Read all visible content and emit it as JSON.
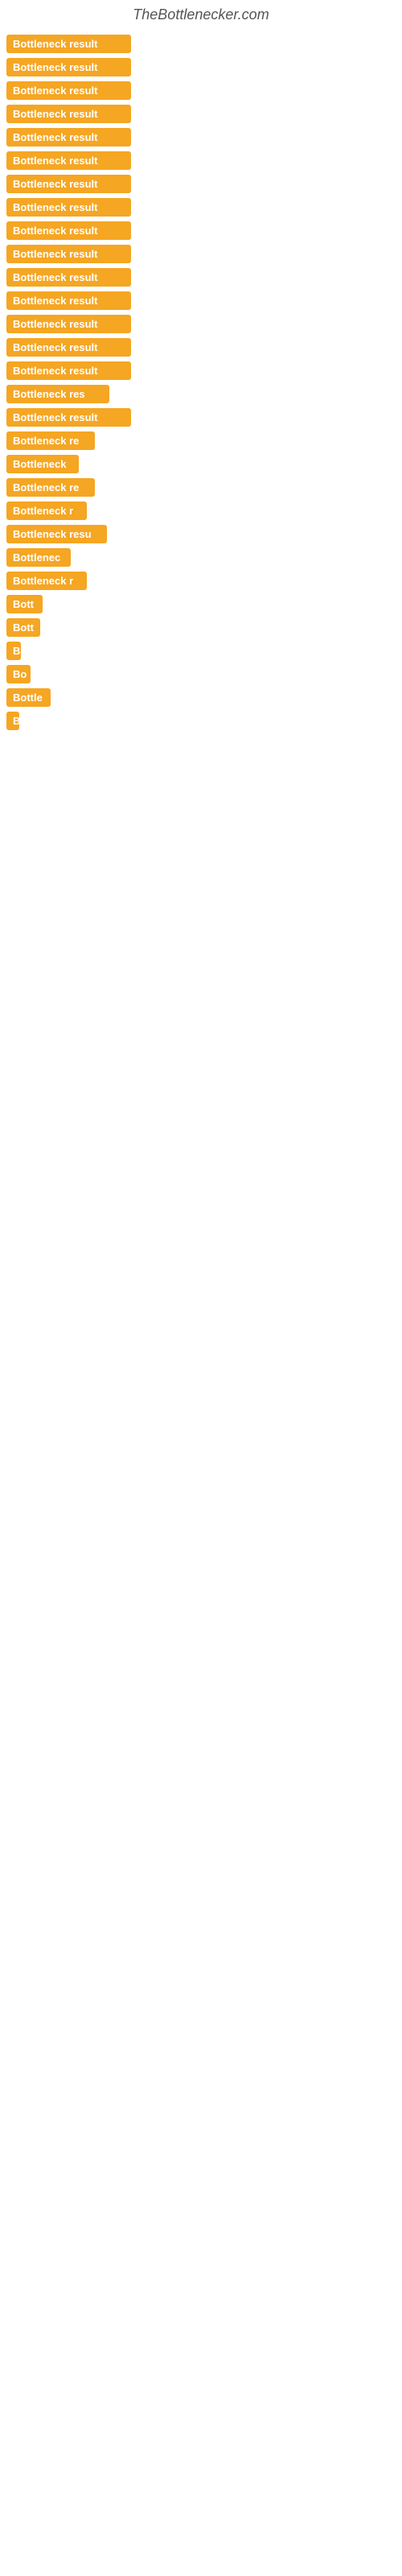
{
  "site": {
    "title": "TheBottlenecker.com"
  },
  "items": [
    {
      "label": "Bottleneck result",
      "width": 155
    },
    {
      "label": "Bottleneck result",
      "width": 155
    },
    {
      "label": "Bottleneck result",
      "width": 155
    },
    {
      "label": "Bottleneck result",
      "width": 155
    },
    {
      "label": "Bottleneck result",
      "width": 155
    },
    {
      "label": "Bottleneck result",
      "width": 155
    },
    {
      "label": "Bottleneck result",
      "width": 155
    },
    {
      "label": "Bottleneck result",
      "width": 155
    },
    {
      "label": "Bottleneck result",
      "width": 155
    },
    {
      "label": "Bottleneck result",
      "width": 155
    },
    {
      "label": "Bottleneck result",
      "width": 155
    },
    {
      "label": "Bottleneck result",
      "width": 155
    },
    {
      "label": "Bottleneck result",
      "width": 155
    },
    {
      "label": "Bottleneck result",
      "width": 155
    },
    {
      "label": "Bottleneck result",
      "width": 155
    },
    {
      "label": "Bottleneck res",
      "width": 128
    },
    {
      "label": "Bottleneck result",
      "width": 155
    },
    {
      "label": "Bottleneck re",
      "width": 110
    },
    {
      "label": "Bottleneck",
      "width": 90
    },
    {
      "label": "Bottleneck re",
      "width": 110
    },
    {
      "label": "Bottleneck r",
      "width": 100
    },
    {
      "label": "Bottleneck resu",
      "width": 125
    },
    {
      "label": "Bottlenec",
      "width": 80
    },
    {
      "label": "Bottleneck r",
      "width": 100
    },
    {
      "label": "Bott",
      "width": 45
    },
    {
      "label": "Bott",
      "width": 42
    },
    {
      "label": "B",
      "width": 18
    },
    {
      "label": "Bo",
      "width": 30
    },
    {
      "label": "Bottle",
      "width": 55
    },
    {
      "label": "B",
      "width": 15
    }
  ]
}
